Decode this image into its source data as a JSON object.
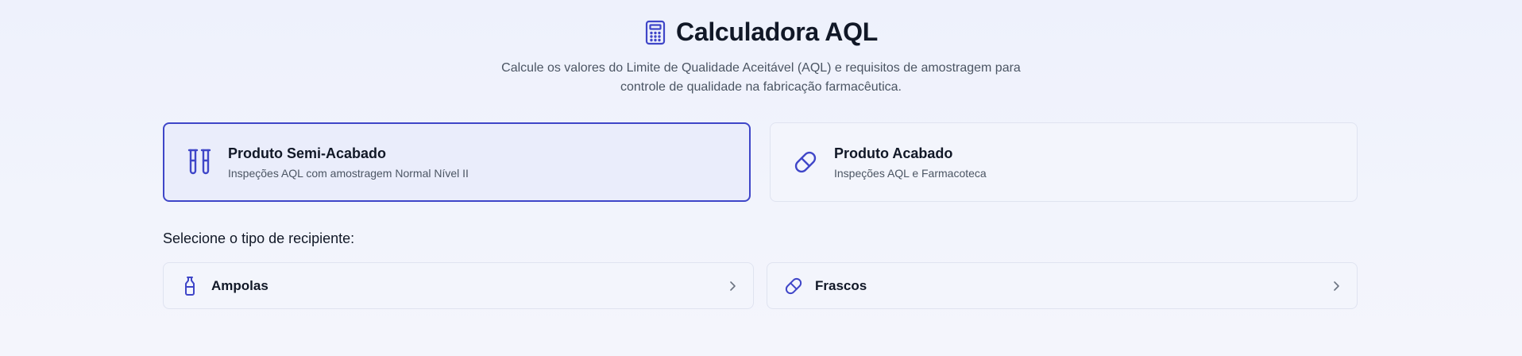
{
  "header": {
    "title": "Calculadora AQL",
    "icon": "calculator-icon",
    "subtitle_line1": "Calcule os valores do Limite de Qualidade Aceitável (AQL) e requisitos de amostragem para",
    "subtitle_line2": "controle de qualidade na fabricação farmacêutica."
  },
  "product_types": [
    {
      "title": "Produto Semi-Acabado",
      "description": "Inspeções AQL com amostragem Normal Nível II",
      "icon": "test-tubes-icon",
      "selected": true
    },
    {
      "title": "Produto Acabado",
      "description": "Inspeções AQL e Farmacoteca",
      "icon": "pill-icon",
      "selected": false
    }
  ],
  "container_section": {
    "label": "Selecione o tipo de recipiente:",
    "options": [
      {
        "label": "Ampolas",
        "icon": "ampoule-icon"
      },
      {
        "label": "Frascos",
        "icon": "pill-icon"
      }
    ]
  },
  "colors": {
    "accent": "#3f46c8",
    "selected_bg": "#eaedfb",
    "card_bg": "#f3f5fc",
    "border": "#dfe3f0"
  }
}
